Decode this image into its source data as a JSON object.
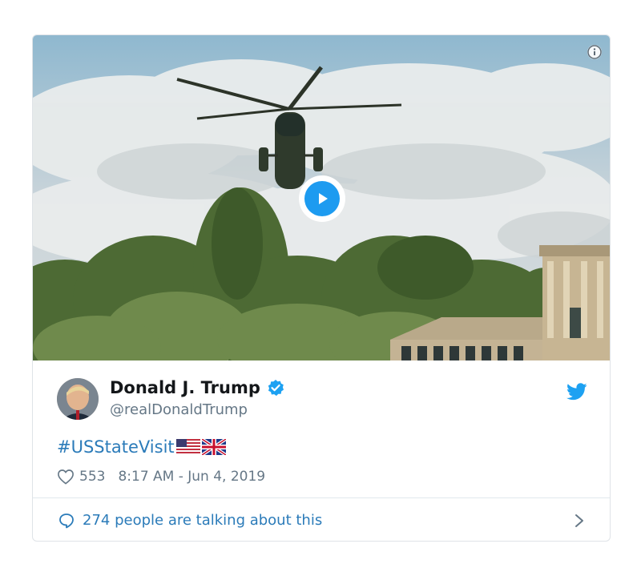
{
  "tweet": {
    "display_name": "Donald J. Trump",
    "handle": "@realDonaldTrump",
    "text": "#USStateVisit",
    "likes": "553",
    "timestamp": "8:17 AM - Jun 4, 2019",
    "conversation_label": "274 people are talking about this",
    "flags": [
      "us-flag-icon",
      "uk-flag-icon"
    ]
  },
  "icons": {
    "info": "info-icon",
    "play": "play-icon",
    "verified": "verified-badge-icon",
    "twitter": "twitter-bird-icon",
    "heart": "heart-icon",
    "bubble": "speech-bubble-icon",
    "chevron": "chevron-right-icon"
  },
  "colors": {
    "link": "#2b7bb9",
    "name": "#14171a",
    "secondary": "#657786",
    "accent": "#1d9bf0",
    "border": "#dfe3e7"
  }
}
